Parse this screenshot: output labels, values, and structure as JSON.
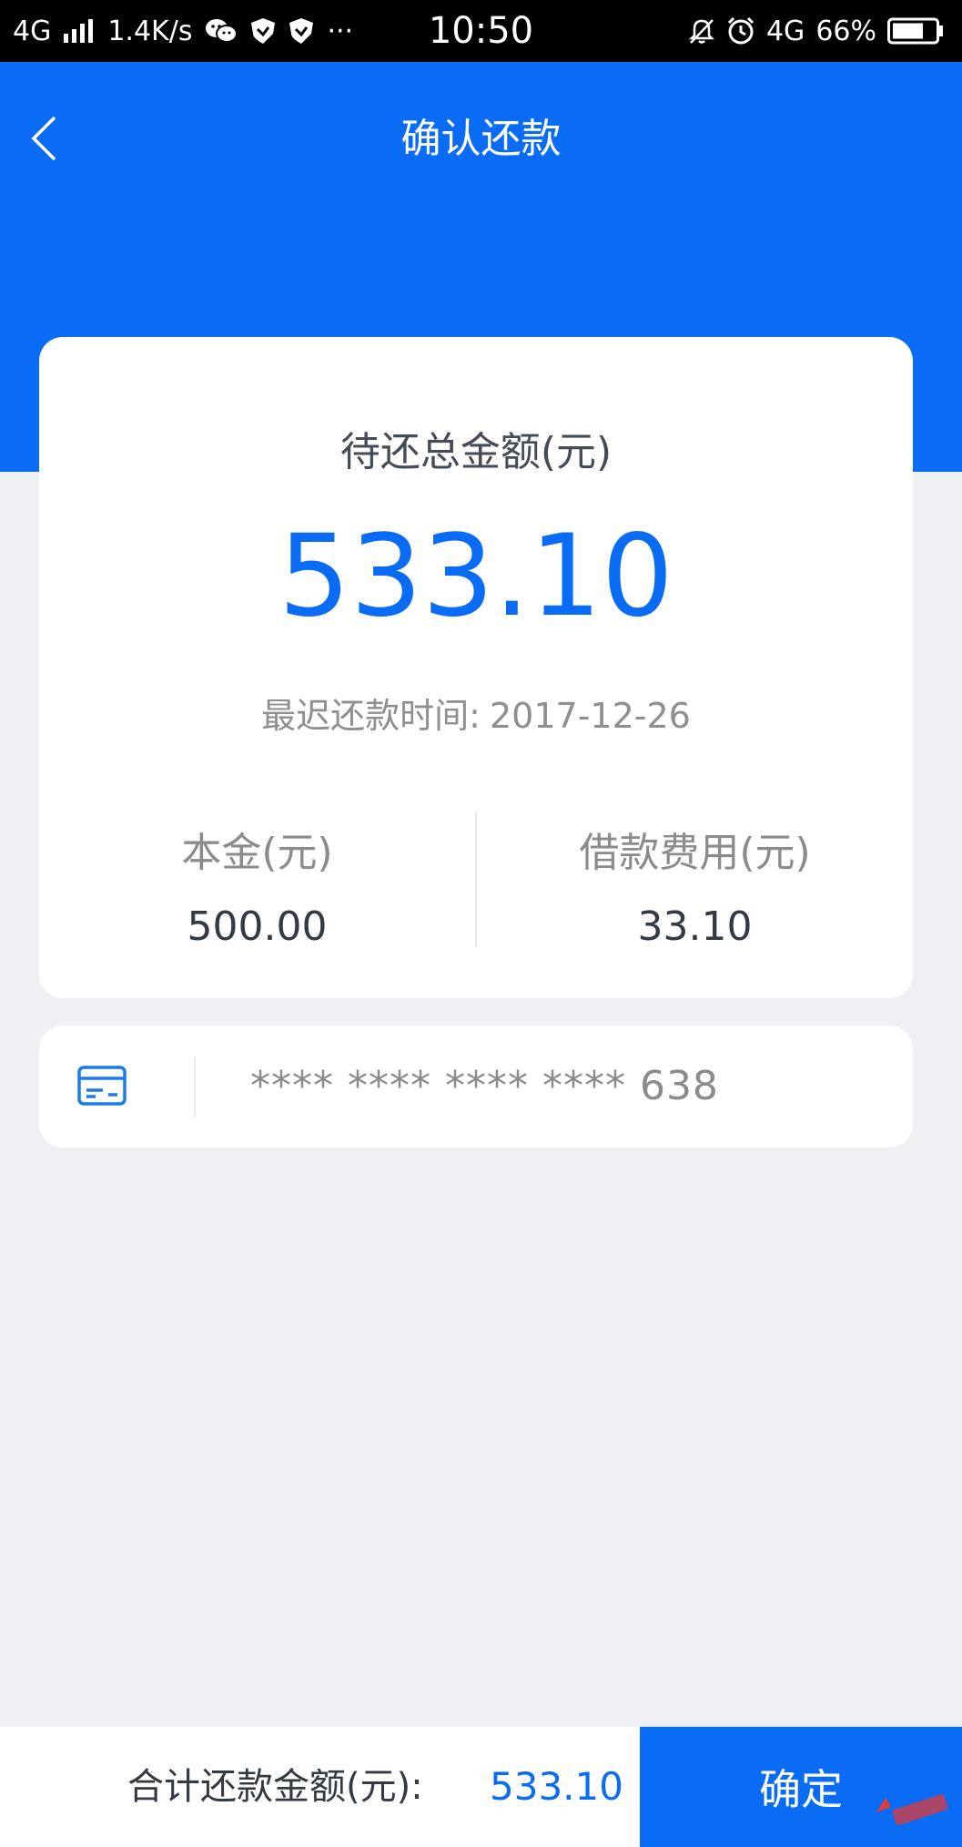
{
  "status_bar": {
    "network": "4G",
    "speed": "1.4K/s",
    "dots": "···",
    "time": "10:50",
    "network_right": "4G",
    "battery": "66%"
  },
  "header": {
    "title": "确认还款"
  },
  "summary": {
    "label": "待还总金额(元)",
    "amount": "533.10",
    "deadline_label": "最迟还款时间:",
    "deadline_date": "2017-12-26",
    "principal_label": "本金(元)",
    "principal_value": "500.00",
    "fee_label": "借款费用(元)",
    "fee_value": "33.10"
  },
  "bank_card": {
    "number": "**** **** **** **** 638"
  },
  "footer": {
    "total_label": "合计还款金额(元):",
    "total_value": "533.10",
    "confirm_label": "确定"
  },
  "colors": {
    "accent": "#0a6cf4",
    "background": "#eff0f4"
  }
}
